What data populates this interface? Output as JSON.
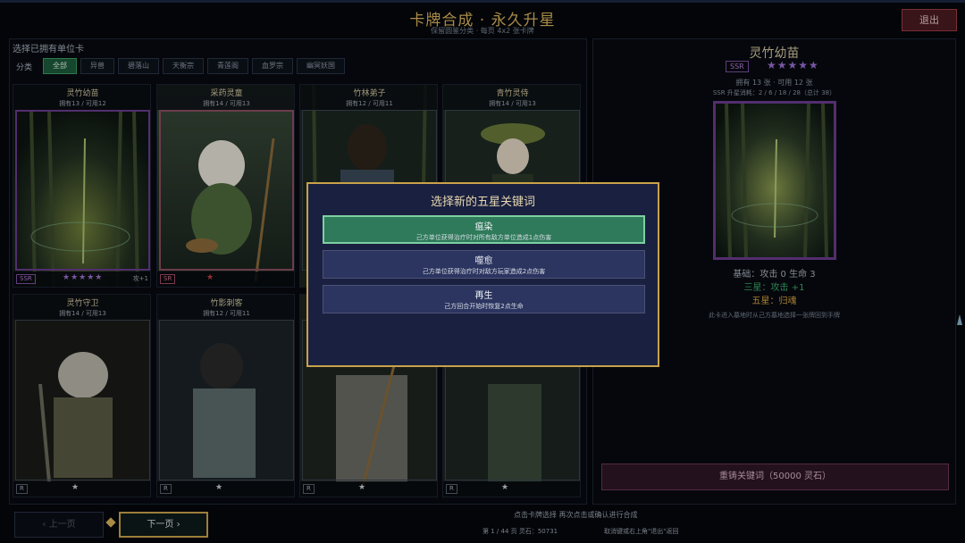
{
  "header": {
    "title": "卡牌合成 · 永久升星",
    "subtitle": "保留圆鉴分类 · 每页 4x2 张卡牌",
    "exit_label": "退出"
  },
  "left_panel": {
    "title": "选择已拥有单位卡",
    "filter_label": "分类",
    "filters": [
      {
        "label": "全部",
        "active": true
      },
      {
        "label": "异兽",
        "active": false
      },
      {
        "label": "碧落山",
        "active": false
      },
      {
        "label": "天衡宗",
        "active": false
      },
      {
        "label": "青莲阁",
        "active": false
      },
      {
        "label": "血罗宗",
        "active": false
      },
      {
        "label": "幽冥妖国",
        "active": false
      }
    ]
  },
  "cards": [
    {
      "name": "灵竹幼苗",
      "count": "拥有13 / 可用12",
      "rarity": "SSR",
      "stars": "★★★★★",
      "star_color": "purple",
      "extra": "攻+1"
    },
    {
      "name": "采药灵童",
      "count": "拥有14 / 可用13",
      "rarity": "SR",
      "stars": "★",
      "star_color": "red",
      "extra": ""
    },
    {
      "name": "竹林弟子",
      "count": "拥有12 / 可用11",
      "rarity": "",
      "stars": "",
      "star_color": "",
      "extra": ""
    },
    {
      "name": "青竹灵侍",
      "count": "拥有14 / 可用13",
      "rarity": "",
      "stars": "",
      "star_color": "",
      "extra": ""
    },
    {
      "name": "灵竹守卫",
      "count": "拥有14 / 可用13",
      "rarity": "R",
      "stars": "★",
      "star_color": "grey",
      "extra": ""
    },
    {
      "name": "竹影刺客",
      "count": "拥有12 / 可用11",
      "rarity": "R",
      "stars": "★",
      "star_color": "grey",
      "extra": ""
    },
    {
      "name": "",
      "count": "",
      "rarity": "R",
      "stars": "★",
      "star_color": "grey",
      "extra": ""
    },
    {
      "name": "",
      "count": "",
      "rarity": "R",
      "stars": "★",
      "star_color": "grey",
      "extra": ""
    }
  ],
  "detail": {
    "name": "灵竹幼苗",
    "rarity": "SSR",
    "stars": "★★★★★",
    "owned": "拥有 13 张 · 可用 12 张",
    "cost": "SSR 升星消耗：2 / 6 / 18 / 28（总计 38）",
    "base": "基础：攻击 0   生命 3",
    "three_star": "三星：攻击 +1",
    "five_star": "五星：归魂",
    "desc": "此卡进入墓地时从己方墓地选择一张牌回到手牌",
    "reforge_label": "重铸关键词（50000 灵石）"
  },
  "footer": {
    "prev_label": "‹  上一页",
    "next_label": "下一页  ›",
    "hint1": "点击卡牌选择   再次点击或确认进行合成",
    "page_info": "第 1 / 44 页     灵石：50731",
    "hint2": "取消键或右上角\"退出\"返回"
  },
  "modal": {
    "title": "选择新的五星关键词",
    "options": [
      {
        "name": "瘟染",
        "desc": "己方单位获得治疗时对所有敌方单位造成1点伤害",
        "selected": true
      },
      {
        "name": "噬愈",
        "desc": "己方单位获得治疗时对敌方玩家造成2点伤害",
        "selected": false
      },
      {
        "name": "再生",
        "desc": "己方回合开始时恢复2点生命",
        "selected": false
      }
    ]
  },
  "colors": {
    "accent_gold": "#c9a24a",
    "ssr_purple": "#9c6fd0",
    "selected_green": "#2e7a5a",
    "modal_bg": "#1a2140"
  }
}
